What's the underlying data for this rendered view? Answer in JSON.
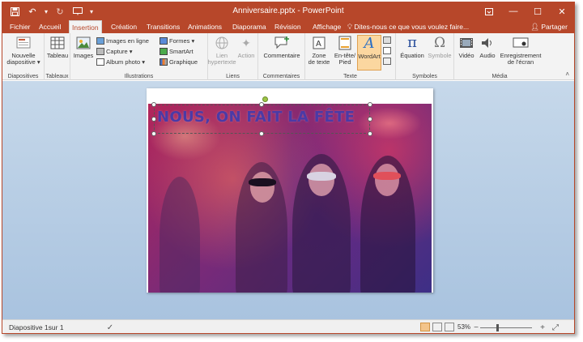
{
  "window": {
    "title": "Anniversaire.pptx - PowerPoint",
    "accent": "#b7472a"
  },
  "qat": {
    "save_icon": "save-icon",
    "undo_icon": "undo-icon",
    "redo_icon": "redo-icon",
    "start_icon": "slideshow-start-icon",
    "customize_icon": "chevron-down-icon"
  },
  "tabs": [
    {
      "label": "Fichier"
    },
    {
      "label": "Accueil"
    },
    {
      "label": "Insertion"
    },
    {
      "label": "Création"
    },
    {
      "label": "Transitions"
    },
    {
      "label": "Animations"
    },
    {
      "label": "Diaporama"
    },
    {
      "label": "Révision"
    },
    {
      "label": "Affichage"
    }
  ],
  "tellme": "Dites-nous ce que vous voulez faire...",
  "share": "Partager",
  "ribbon": {
    "groups": {
      "diapositives": "Diapositives",
      "tableaux": "Tableaux",
      "illustrations": "Illustrations",
      "liens": "Liens",
      "commentaires": "Commentaires",
      "texte": "Texte",
      "symboles": "Symboles",
      "media": "Média"
    },
    "buttons": {
      "nouvelle_diapo_1": "Nouvelle",
      "nouvelle_diapo_2": "diapositive ▾",
      "tableau": "Tableau",
      "images": "Images",
      "images_en_ligne": "Images en ligne",
      "capture": "Capture ▾",
      "album_photo": "Album photo ▾",
      "formes": "Formes ▾",
      "smartart": "SmartArt",
      "graphique": "Graphique",
      "lien_hypertexte_1": "Lien",
      "lien_hypertexte_2": "hypertexte",
      "action": "Action",
      "commentaire": "Commentaire",
      "zone_texte_1": "Zone",
      "zone_texte_2": "de texte",
      "entete_1": "En-tête/",
      "entete_2": "Pied",
      "wordart": "WordArt",
      "equation": "Équation",
      "symbole": "Symbole",
      "video": "Vidéo",
      "audio": "Audio",
      "enregistrement_1": "Enregistrement",
      "enregistrement_2": "de l'écran"
    }
  },
  "slide": {
    "title": "NOUS, ON FAIT LA FÊTE"
  },
  "status": {
    "slide_info": "Diapositive 1sur 1",
    "zoom": "53%"
  }
}
